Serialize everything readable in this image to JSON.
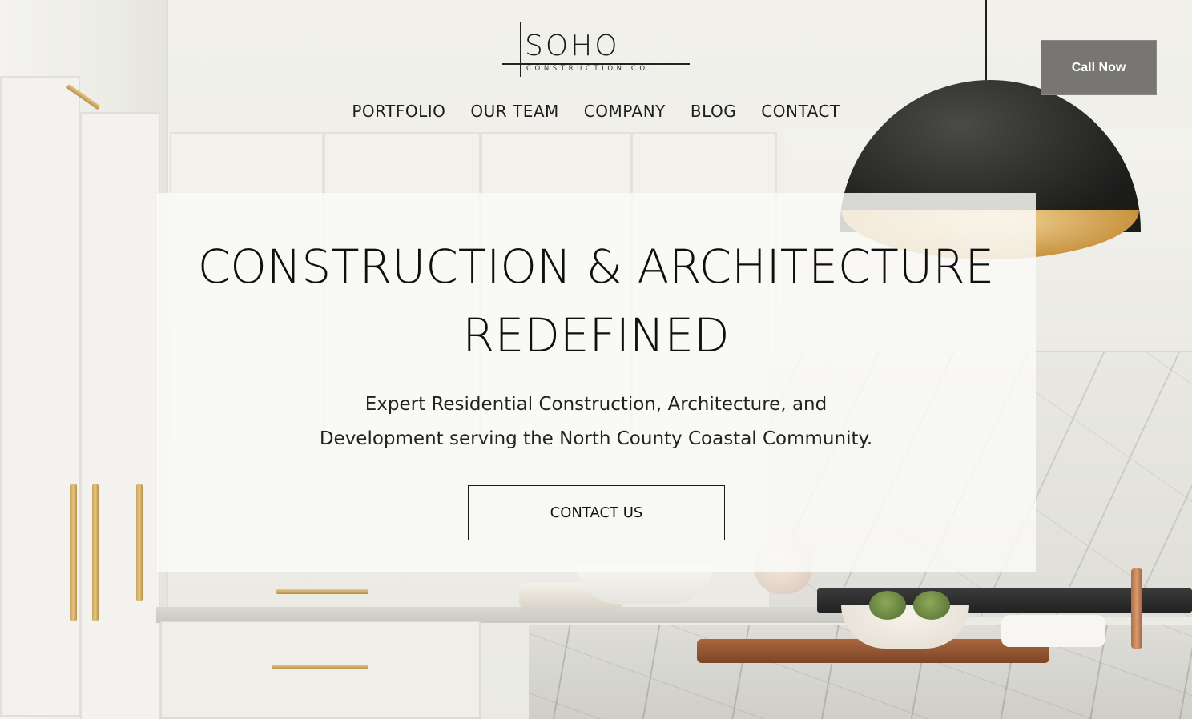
{
  "header": {
    "logo": {
      "name": "SOHO",
      "sub": "CONSTRUCTION CO."
    },
    "nav": [
      {
        "label": "PORTFOLIO"
      },
      {
        "label": "OUR TEAM"
      },
      {
        "label": "COMPANY"
      },
      {
        "label": "BLOG"
      },
      {
        "label": "CONTACT"
      }
    ],
    "call_button": "Call Now"
  },
  "hero": {
    "headline_line1": "CONSTRUCTION & ARCHITECTURE",
    "headline_line2": "REDEFINED",
    "sub_line1": "Expert Residential Construction, Architecture, and",
    "sub_line2": "Development serving the North County Coastal Community.",
    "cta": "CONTACT US",
    "background_image": "kitchen-interior"
  },
  "colors": {
    "call_button_bg": "#777672",
    "text": "#111111",
    "panel_bg": "#fafaf8"
  }
}
